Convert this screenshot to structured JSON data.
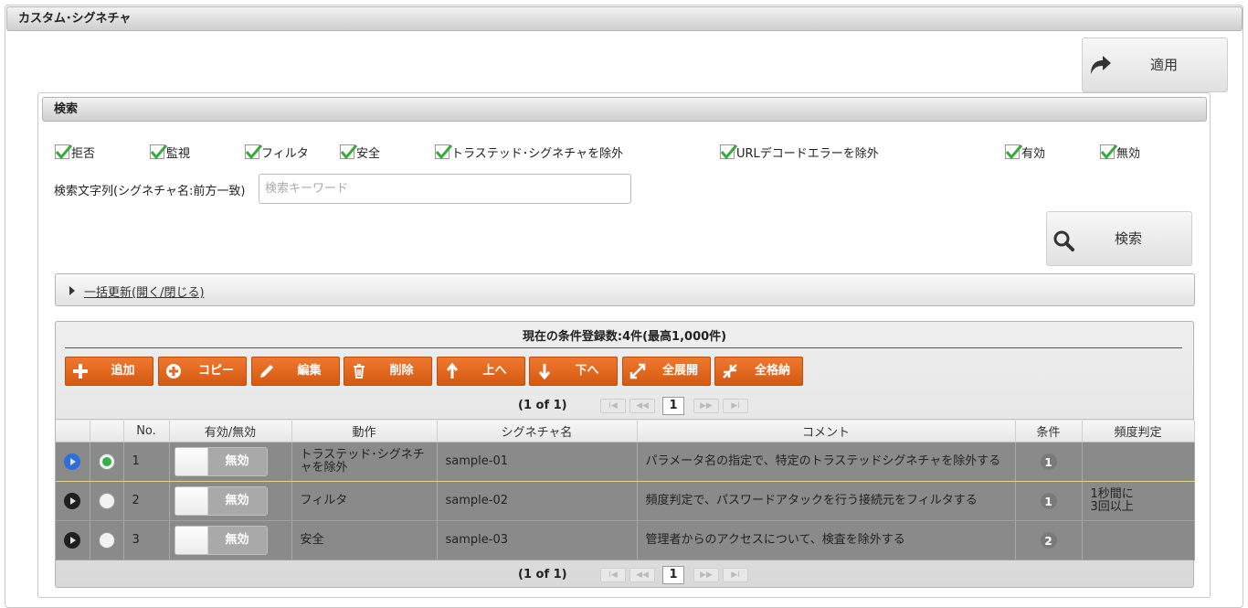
{
  "title": "カスタム･シグネチャ",
  "apply_label": "適用",
  "search": {
    "header": "検索",
    "checkboxes": [
      {
        "label": "拒否",
        "checked": true
      },
      {
        "label": "監視",
        "checked": true
      },
      {
        "label": "フィルタ",
        "checked": true
      },
      {
        "label": "安全",
        "checked": true
      },
      {
        "label": "トラステッド･シグネチャを除外",
        "checked": true
      },
      {
        "label": "URLデコードエラーを除外",
        "checked": true
      },
      {
        "label": "有効",
        "checked": true
      },
      {
        "label": "無効",
        "checked": true
      }
    ],
    "keyword_label": "検索文字列(シグネチャ名:前方一致)",
    "keyword_placeholder": "検索キーワード",
    "keyword_value": "",
    "button_label": "検索"
  },
  "bulk_update_label": "一括更新(開く/閉じる)",
  "grid": {
    "caption": "現在の条件登録数:4件(最高1,000件)",
    "toolbar": [
      {
        "label": "追加",
        "icon": "plus-icon"
      },
      {
        "label": "コピー",
        "icon": "copy-icon"
      },
      {
        "label": "編集",
        "icon": "pencil-icon"
      },
      {
        "label": "削除",
        "icon": "trash-icon"
      },
      {
        "label": "上へ",
        "icon": "arrow-up-icon"
      },
      {
        "label": "下へ",
        "icon": "arrow-down-icon"
      },
      {
        "label": "全展開",
        "icon": "expand-icon"
      },
      {
        "label": "全格納",
        "icon": "collapse-icon"
      }
    ],
    "pager": {
      "info": "(1 of 1)",
      "page": "1",
      "first": "I◀",
      "prev": "◀◀",
      "next": "▶▶",
      "last": "▶I"
    },
    "columns": [
      "No.",
      "有効/無効",
      "動作",
      "シグネチャ名",
      "コメント",
      "条件",
      "頻度判定"
    ],
    "rows": [
      {
        "no": "1",
        "toggle": "無効",
        "action": "トラステッド･シグネチャを除外",
        "name": "sample-01",
        "comment": "パラメータ名の指定で、特定のトラステッドシグネチャを除外する",
        "cond": "1",
        "freq": "",
        "selected": true
      },
      {
        "no": "2",
        "toggle": "無効",
        "action": "フィルタ",
        "name": "sample-02",
        "comment": "頻度判定で、パスワードアタックを行う接続元をフィルタする",
        "cond": "1",
        "freq": "1秒間に\n3回以上",
        "selected": false
      },
      {
        "no": "3",
        "toggle": "無効",
        "action": "安全",
        "name": "sample-03",
        "comment": "管理者からのアクセスについて、検査を除外する",
        "cond": "2",
        "freq": "",
        "selected": false
      }
    ]
  },
  "colors": {
    "accent": "#e8672a",
    "row_bg": "#8a8a8a",
    "check": "#3aaa3a"
  }
}
